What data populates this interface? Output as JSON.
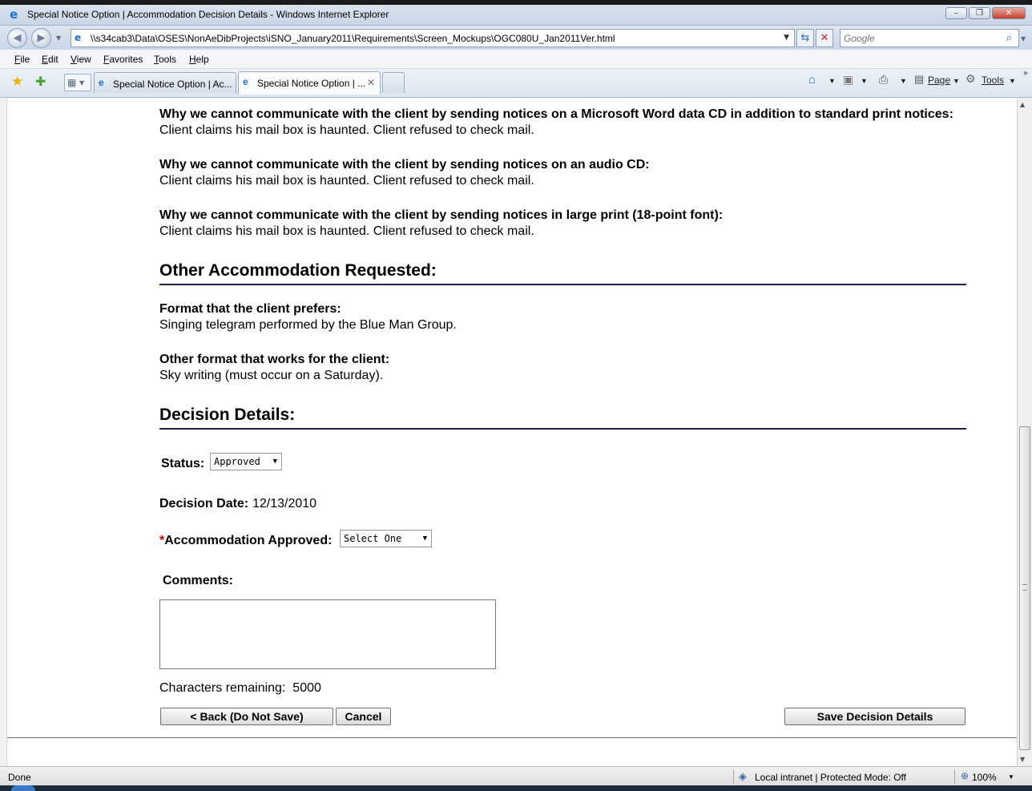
{
  "window": {
    "title": "Special Notice Option | Accommodation Decision Details - Windows Internet Explorer",
    "minimize": "–",
    "maximize": "❐",
    "close": "✕"
  },
  "address_bar": {
    "url": "\\\\s34cab3\\Data\\OSES\\NonAeDibProjects\\iSNO_January2011\\Requirements\\Screen_Mockups\\OGC080U_Jan2011Ver.html",
    "search_placeholder": "Google"
  },
  "menu": {
    "file": "File",
    "edit": "Edit",
    "view": "View",
    "favorites": "Favorites",
    "tools": "Tools",
    "help": "Help"
  },
  "tabs": [
    {
      "label": "Special Notice Option | Ac..."
    },
    {
      "label": "Special Notice Option | ..."
    }
  ],
  "commands": {
    "page": "Page",
    "tools": "Tools"
  },
  "icons": {
    "back": "back-arrow-icon",
    "forward": "forward-arrow-icon",
    "refresh": "refresh-icon",
    "stop": "stop-icon",
    "search": "magnifier-icon",
    "favorites": "star-icon",
    "add_favorites": "add-favorites-icon",
    "home": "home-icon",
    "feeds": "feeds-icon",
    "print": "print-icon"
  },
  "content": {
    "q1": "Why we cannot communicate with the client by sending notices on a Microsoft Word data CD in addition to standard print notices:",
    "a1": "Client claims his mail box is haunted. Client refused to check mail.",
    "q2": "Why we cannot communicate with the client by sending notices on an audio CD:",
    "a2": "Client claims his mail box is haunted. Client refused to check mail.",
    "q3": "Why we cannot communicate with the client by sending notices in large print (18-point font):",
    "a3": "Client claims his mail box is haunted. Client refused to check mail.",
    "other_heading": "Other Accommodation Requested:",
    "format_label": "Format that the client prefers:",
    "format_value": "Singing telegram performed by the Blue Man Group.",
    "other_format_label": "Other format that works for the client:",
    "other_format_value": "Sky writing (must occur on a Saturday).",
    "decision_heading": "Decision Details:",
    "status_label": "Status:",
    "status_value": "Approved",
    "decision_date_label": "Decision Date:",
    "decision_date_value": "12/13/2010",
    "required_marker": "*",
    "accommodation_label": "Accommodation Approved:",
    "accommodation_value": "Select One",
    "comments_label": "Comments:",
    "comments_value": "",
    "chars_remaining_label": "Characters remaining:",
    "chars_remaining_value": "5000",
    "back_button": "< Back (Do Not Save)",
    "cancel_button": "Cancel",
    "save_button": "Save Decision Details"
  },
  "status_bar": {
    "left": "Done",
    "zone": "Local intranet | Protected Mode: Off",
    "zoom": "100%"
  }
}
